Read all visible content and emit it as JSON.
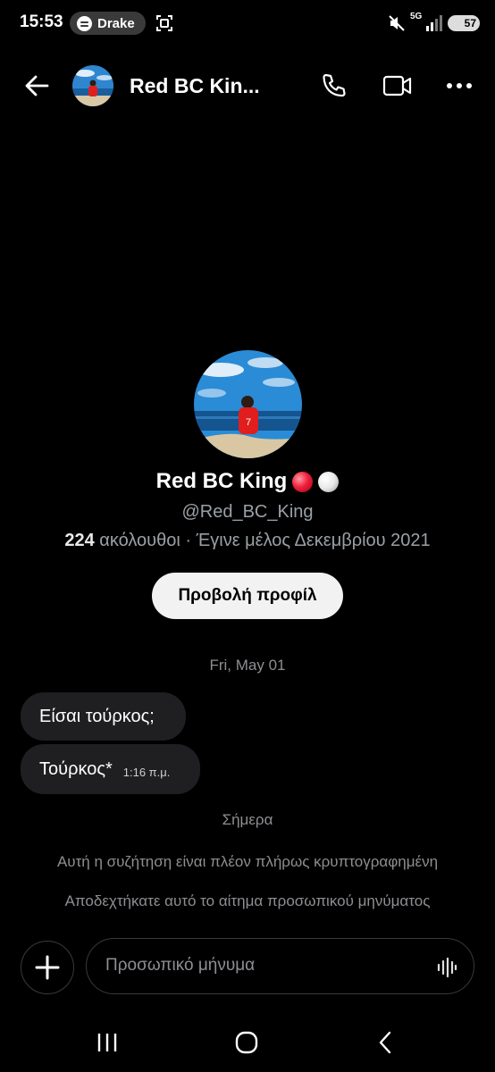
{
  "status_bar": {
    "time": "15:53",
    "media_label": "Drake",
    "network": "5G",
    "battery": "57"
  },
  "header": {
    "title": "Red BC Kin..."
  },
  "profile": {
    "name": "Red BC King",
    "handle": "@Red_BC_King",
    "followers_count": "224",
    "followers_label": "ακόλουθοι",
    "separator": " · ",
    "joined": "Έγινε μέλος Δεκεμβρίου 2021",
    "view_profile_label": "Προβολή προφίλ"
  },
  "conversation": {
    "date_label": "Fri, May 01",
    "messages": [
      {
        "text": "Είσαι τούρκος;",
        "time": ""
      },
      {
        "text": "Τούρκος*",
        "time": "1:16 π.μ."
      }
    ],
    "today_label": "Σήμερα",
    "system_notes": [
      "Αυτή η συζήτηση είναι πλέον πλήρως κρυπτογραφημένη",
      "Αποδεχτήκατε αυτό το αίτημα προσωπικού μηνύματος"
    ]
  },
  "composer": {
    "placeholder": "Προσωπικό μήνυμα",
    "value": ""
  },
  "colors": {
    "background": "#000000",
    "bubble": "#1f1f21",
    "muted_text": "#8e8e93",
    "button_bg": "#f2f2f2"
  }
}
